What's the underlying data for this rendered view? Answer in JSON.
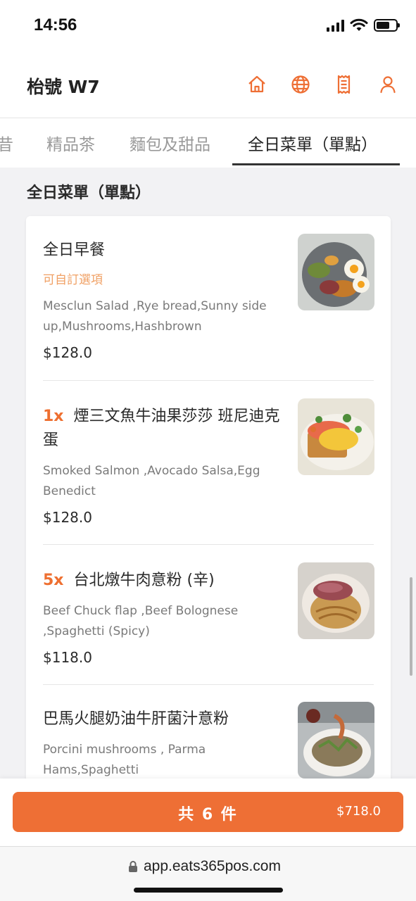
{
  "status_bar": {
    "time": "14:56"
  },
  "header": {
    "store_name": "枱號 W7",
    "icons": [
      "home-icon",
      "globe-icon",
      "receipt-icon",
      "user-icon"
    ],
    "accent_color": "#ee6f35"
  },
  "tabs": [
    {
      "label": "昔"
    },
    {
      "label": "精品茶"
    },
    {
      "label": "麵包及甜品"
    },
    {
      "label": "全日菜單（單點）",
      "active": true
    }
  ],
  "section": {
    "title": "全日菜單（單點）"
  },
  "menu_items": [
    {
      "qty": "",
      "name": "全日早餐",
      "option": "可自訂選項",
      "description": "Mesclun Salad ,Rye bread,Sunny side up,Mushrooms,Hashbrown",
      "price": "$128.0"
    },
    {
      "qty": "1x",
      "name": "煙三文魚牛油果莎莎 班尼迪克蛋",
      "option": "",
      "description": "Smoked Salmon ,Avocado Salsa,Egg Benedict",
      "price": "$128.0"
    },
    {
      "qty": "5x",
      "name": "台北燉牛肉意粉 (辛)",
      "option": "",
      "description": "Beef Chuck flap ,Beef Bolognese ,Spaghetti (Spicy)",
      "price": "$118.0"
    },
    {
      "qty": "",
      "name": "巴馬火腿奶油牛肝菌汁意粉",
      "option": "",
      "description": "Porcini mushrooms , Parma Hams,Spaghetti",
      "price": ""
    }
  ],
  "cart": {
    "count_label": "共 6 件",
    "total": "$718.0"
  },
  "browser": {
    "url": "app.eats365pos.com"
  }
}
